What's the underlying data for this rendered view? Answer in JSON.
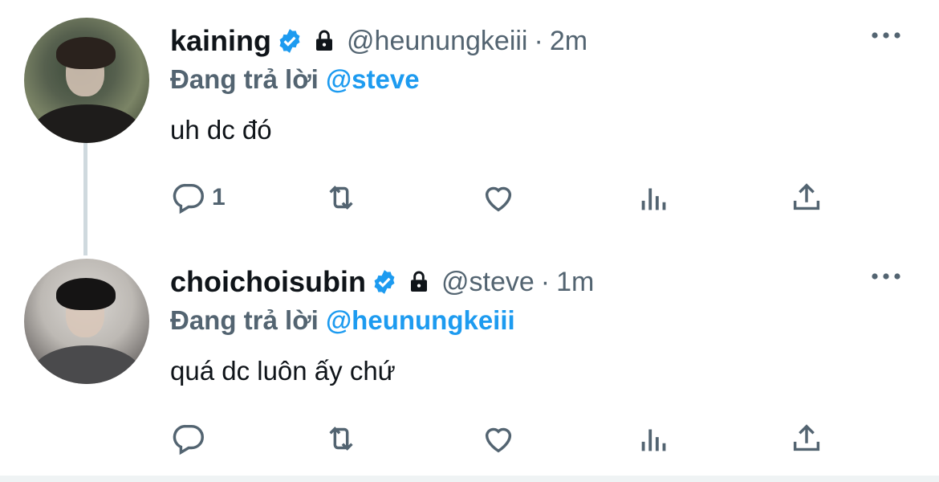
{
  "tweets": [
    {
      "name": "kaining",
      "handle": "@heunungkeiii",
      "separator": "·",
      "time": "2m",
      "replying_prefix": "Đang trả lời",
      "replying_to": "@steve",
      "text": "uh dc đó",
      "reply_count": "1"
    },
    {
      "name": "choichoisubin",
      "handle": "@steve",
      "separator": "·",
      "time": "1m",
      "replying_prefix": "Đang trả lời",
      "replying_to": "@heunungkeiii",
      "text": "quá dc luôn ấy chứ",
      "reply_count": ""
    }
  ],
  "colors": {
    "accent": "#1d9bf0",
    "secondary_text": "#536471",
    "primary_text": "#0f1419",
    "thread_line": "#cfd9de"
  },
  "icons": [
    "verified-badge-icon",
    "lock-icon",
    "more-icon",
    "reply-icon",
    "retweet-icon",
    "like-icon",
    "views-icon",
    "share-icon"
  ]
}
